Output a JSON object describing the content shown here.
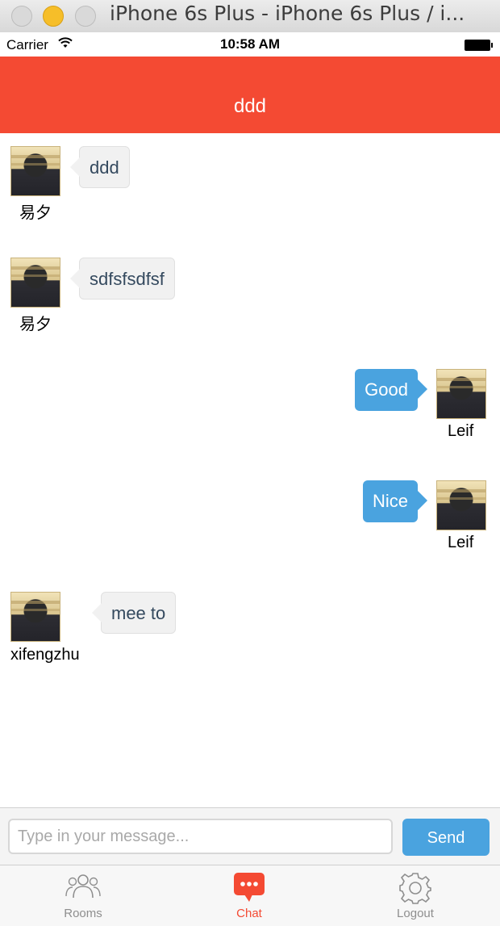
{
  "window": {
    "title": "iPhone 6s Plus - iPhone 6s Plus / i..."
  },
  "status_bar": {
    "carrier": "Carrier",
    "time": "10:58 AM"
  },
  "nav": {
    "title": "ddd"
  },
  "messages": [
    {
      "direction": "in",
      "sender": "易夕",
      "text": "ddd"
    },
    {
      "direction": "in",
      "sender": "易夕",
      "text": "sdfsfsdfsf"
    },
    {
      "direction": "out",
      "sender": "Leif",
      "text": "Good"
    },
    {
      "direction": "out",
      "sender": "Leif",
      "text": "Nice"
    },
    {
      "direction": "in",
      "sender": "xifengzhu",
      "text": "mee to"
    }
  ],
  "composer": {
    "placeholder": "Type in your message...",
    "send_label": "Send"
  },
  "tab_bar": {
    "items": [
      {
        "label": "Rooms",
        "icon": "people-icon"
      },
      {
        "label": "Chat",
        "icon": "chat-bubble-icon",
        "active": true
      },
      {
        "label": "Logout",
        "icon": "gear-icon"
      }
    ]
  },
  "colors": {
    "nav_bar": "#f44a33",
    "outgoing_bubble": "#4aa3df",
    "incoming_bubble": "#f1f1f1",
    "active_tab": "#f44a33"
  }
}
